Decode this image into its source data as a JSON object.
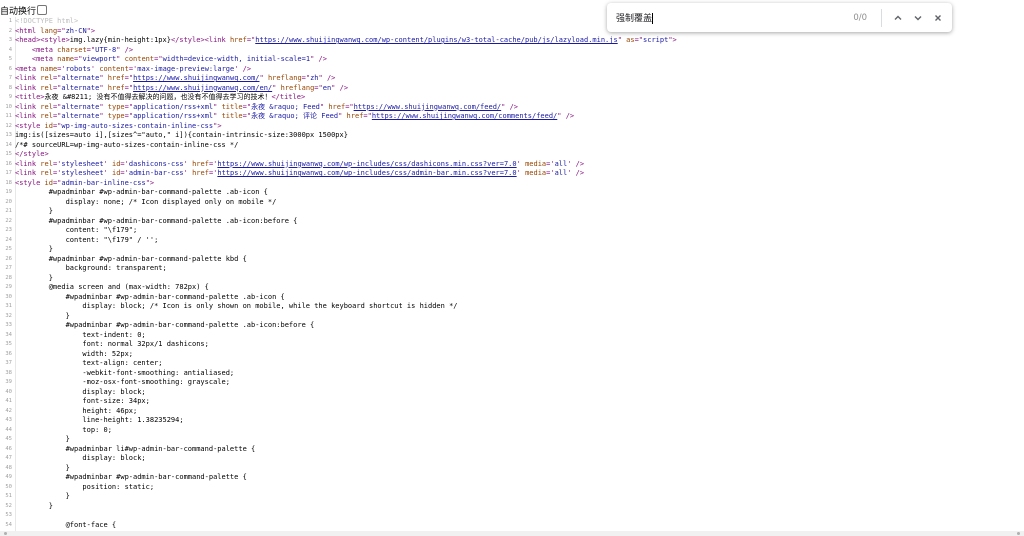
{
  "wrap_toggle": {
    "label": "自动换行",
    "checked": false
  },
  "find_bar": {
    "query": "强制覆盖",
    "count": "0/0",
    "icons": [
      "chevron-up-icon",
      "chevron-down-icon",
      "close-icon"
    ]
  },
  "lines": [
    {
      "n": "1",
      "parts": [
        [
          "doc",
          "<!DOCTYPE html>"
        ]
      ]
    },
    {
      "n": "2",
      "parts": [
        [
          "tag",
          "<html "
        ],
        [
          "attr",
          "lang"
        ],
        [
          "tag",
          "=\""
        ],
        [
          "val",
          "zh-CN"
        ],
        [
          "tag",
          "\">"
        ]
      ]
    },
    {
      "n": "3",
      "parts": [
        [
          "tag",
          "<head><style>"
        ],
        [
          "code",
          "img.lazy{min-height:1px}"
        ],
        [
          "tag",
          "</style><link "
        ],
        [
          "attr",
          "href"
        ],
        [
          "tag",
          "=\""
        ],
        [
          "link",
          "https://www.shuijingwanwq.com/wp-content/plugins/w3-total-cache/pub/js/lazyload.min.js"
        ],
        [
          "tag",
          "\" "
        ],
        [
          "attr",
          "as"
        ],
        [
          "tag",
          "=\""
        ],
        [
          "val",
          "script"
        ],
        [
          "tag",
          "\">"
        ]
      ]
    },
    {
      "n": "4",
      "parts": [
        [
          "code",
          "    "
        ],
        [
          "tag",
          "<meta "
        ],
        [
          "attr",
          "charset"
        ],
        [
          "tag",
          "=\""
        ],
        [
          "val",
          "UTF-8"
        ],
        [
          "tag",
          "\" />"
        ]
      ]
    },
    {
      "n": "5",
      "parts": [
        [
          "code",
          "    "
        ],
        [
          "tag",
          "<meta "
        ],
        [
          "attr",
          "name"
        ],
        [
          "tag",
          "=\""
        ],
        [
          "val",
          "viewport"
        ],
        [
          "tag",
          "\" "
        ],
        [
          "attr",
          "content"
        ],
        [
          "tag",
          "=\""
        ],
        [
          "val",
          "width=device-width, initial-scale=1"
        ],
        [
          "tag",
          "\" />"
        ]
      ]
    },
    {
      "n": "6",
      "parts": [
        [
          "tag",
          "<meta "
        ],
        [
          "attr",
          "name"
        ],
        [
          "tag",
          "='"
        ],
        [
          "val",
          "robots"
        ],
        [
          "tag",
          "' "
        ],
        [
          "attr",
          "content"
        ],
        [
          "tag",
          "='"
        ],
        [
          "val",
          "max-image-preview:large"
        ],
        [
          "tag",
          "' />"
        ]
      ]
    },
    {
      "n": "7",
      "parts": [
        [
          "tag",
          "<link "
        ],
        [
          "attr",
          "rel"
        ],
        [
          "tag",
          "=\""
        ],
        [
          "val",
          "alternate"
        ],
        [
          "tag",
          "\" "
        ],
        [
          "attr",
          "href"
        ],
        [
          "tag",
          "=\""
        ],
        [
          "link",
          "https://www.shuijingwanwq.com/"
        ],
        [
          "tag",
          "\" "
        ],
        [
          "attr",
          "hreflang"
        ],
        [
          "tag",
          "=\""
        ],
        [
          "val",
          "zh"
        ],
        [
          "tag",
          "\" />"
        ]
      ]
    },
    {
      "n": "8",
      "parts": [
        [
          "tag",
          "<link "
        ],
        [
          "attr",
          "rel"
        ],
        [
          "tag",
          "=\""
        ],
        [
          "val",
          "alternate"
        ],
        [
          "tag",
          "\" "
        ],
        [
          "attr",
          "href"
        ],
        [
          "tag",
          "=\""
        ],
        [
          "link",
          "https://www.shuijingwanwq.com/en/"
        ],
        [
          "tag",
          "\" "
        ],
        [
          "attr",
          "hreflang"
        ],
        [
          "tag",
          "=\""
        ],
        [
          "val",
          "en"
        ],
        [
          "tag",
          "\" />"
        ]
      ]
    },
    {
      "n": "9",
      "parts": [
        [
          "tag",
          "<title>"
        ],
        [
          "code",
          "永夜 &#8211; 没有不值得去解决的问题，也没有不值得去学习的技术！"
        ],
        [
          "tag",
          "</title>"
        ]
      ]
    },
    {
      "n": "10",
      "parts": [
        [
          "tag",
          "<link "
        ],
        [
          "attr",
          "rel"
        ],
        [
          "tag",
          "=\""
        ],
        [
          "val",
          "alternate"
        ],
        [
          "tag",
          "\" "
        ],
        [
          "attr",
          "type"
        ],
        [
          "tag",
          "=\""
        ],
        [
          "val",
          "application/rss+xml"
        ],
        [
          "tag",
          "\" "
        ],
        [
          "attr",
          "title"
        ],
        [
          "tag",
          "=\""
        ],
        [
          "val",
          "永夜 &raquo; Feed"
        ],
        [
          "tag",
          "\" "
        ],
        [
          "attr",
          "href"
        ],
        [
          "tag",
          "=\""
        ],
        [
          "link",
          "https://www.shuijingwanwq.com/feed/"
        ],
        [
          "tag",
          "\" />"
        ]
      ]
    },
    {
      "n": "11",
      "parts": [
        [
          "tag",
          "<link "
        ],
        [
          "attr",
          "rel"
        ],
        [
          "tag",
          "=\""
        ],
        [
          "val",
          "alternate"
        ],
        [
          "tag",
          "\" "
        ],
        [
          "attr",
          "type"
        ],
        [
          "tag",
          "=\""
        ],
        [
          "val",
          "application/rss+xml"
        ],
        [
          "tag",
          "\" "
        ],
        [
          "attr",
          "title"
        ],
        [
          "tag",
          "=\""
        ],
        [
          "val",
          "永夜 &raquo; 评论 Feed"
        ],
        [
          "tag",
          "\" "
        ],
        [
          "attr",
          "href"
        ],
        [
          "tag",
          "=\""
        ],
        [
          "link",
          "https://www.shuijingwanwq.com/comments/feed/"
        ],
        [
          "tag",
          "\" />"
        ]
      ]
    },
    {
      "n": "12",
      "parts": [
        [
          "tag",
          "<style "
        ],
        [
          "attr",
          "id"
        ],
        [
          "tag",
          "=\""
        ],
        [
          "val",
          "wp-img-auto-sizes-contain-inline-css"
        ],
        [
          "tag",
          "\">"
        ]
      ]
    },
    {
      "n": "13",
      "parts": [
        [
          "code",
          "img:is([sizes=auto i],[sizes^=\"auto,\" i]){contain-intrinsic-size:3000px 1500px}"
        ]
      ]
    },
    {
      "n": "14",
      "parts": [
        [
          "code",
          "/*# sourceURL=wp-img-auto-sizes-contain-inline-css */"
        ]
      ]
    },
    {
      "n": "15",
      "parts": [
        [
          "tag",
          "</style>"
        ]
      ]
    },
    {
      "n": "16",
      "parts": [
        [
          "tag",
          "<link "
        ],
        [
          "attr",
          "rel"
        ],
        [
          "tag",
          "='"
        ],
        [
          "val",
          "stylesheet"
        ],
        [
          "tag",
          "' "
        ],
        [
          "attr",
          "id"
        ],
        [
          "tag",
          "='"
        ],
        [
          "val",
          "dashicons-css"
        ],
        [
          "tag",
          "' "
        ],
        [
          "attr",
          "href"
        ],
        [
          "tag",
          "='"
        ],
        [
          "link",
          "https://www.shuijingwanwq.com/wp-includes/css/dashicons.min.css?ver=7.0"
        ],
        [
          "tag",
          "' "
        ],
        [
          "attr",
          "media"
        ],
        [
          "tag",
          "='"
        ],
        [
          "val",
          "all"
        ],
        [
          "tag",
          "' />"
        ]
      ]
    },
    {
      "n": "17",
      "parts": [
        [
          "tag",
          "<link "
        ],
        [
          "attr",
          "rel"
        ],
        [
          "tag",
          "='"
        ],
        [
          "val",
          "stylesheet"
        ],
        [
          "tag",
          "' "
        ],
        [
          "attr",
          "id"
        ],
        [
          "tag",
          "='"
        ],
        [
          "val",
          "admin-bar-css"
        ],
        [
          "tag",
          "' "
        ],
        [
          "attr",
          "href"
        ],
        [
          "tag",
          "='"
        ],
        [
          "link",
          "https://www.shuijingwanwq.com/wp-includes/css/admin-bar.min.css?ver=7.0"
        ],
        [
          "tag",
          "' "
        ],
        [
          "attr",
          "media"
        ],
        [
          "tag",
          "='"
        ],
        [
          "val",
          "all"
        ],
        [
          "tag",
          "' />"
        ]
      ]
    },
    {
      "n": "18",
      "parts": [
        [
          "tag",
          "<style "
        ],
        [
          "attr",
          "id"
        ],
        [
          "tag",
          "=\""
        ],
        [
          "val",
          "admin-bar-inline-css"
        ],
        [
          "tag",
          "\">"
        ]
      ]
    },
    {
      "n": "19",
      "parts": [
        [
          "code",
          "        #wpadminbar #wp-admin-bar-command-palette .ab-icon {"
        ]
      ]
    },
    {
      "n": "20",
      "parts": [
        [
          "code",
          "            display: none; /* Icon displayed only on mobile */"
        ]
      ]
    },
    {
      "n": "21",
      "parts": [
        [
          "code",
          "        }"
        ]
      ]
    },
    {
      "n": "22",
      "parts": [
        [
          "code",
          "        #wpadminbar #wp-admin-bar-command-palette .ab-icon:before {"
        ]
      ]
    },
    {
      "n": "23",
      "parts": [
        [
          "code",
          "            content: \"\\f179\";"
        ]
      ]
    },
    {
      "n": "24",
      "parts": [
        [
          "code",
          "            content: \"\\f179\" / '';"
        ]
      ]
    },
    {
      "n": "25",
      "parts": [
        [
          "code",
          "        }"
        ]
      ]
    },
    {
      "n": "26",
      "parts": [
        [
          "code",
          "        #wpadminbar #wp-admin-bar-command-palette kbd {"
        ]
      ]
    },
    {
      "n": "27",
      "parts": [
        [
          "code",
          "            background: transparent;"
        ]
      ]
    },
    {
      "n": "28",
      "parts": [
        [
          "code",
          "        }"
        ]
      ]
    },
    {
      "n": "29",
      "parts": [
        [
          "code",
          "        @media screen and (max-width: 782px) {"
        ]
      ]
    },
    {
      "n": "30",
      "parts": [
        [
          "code",
          "            #wpadminbar #wp-admin-bar-command-palette .ab-icon {"
        ]
      ]
    },
    {
      "n": "31",
      "parts": [
        [
          "code",
          "                display: block; /* Icon is only shown on mobile, while the keyboard shortcut is hidden */"
        ]
      ]
    },
    {
      "n": "32",
      "parts": [
        [
          "code",
          "            }"
        ]
      ]
    },
    {
      "n": "33",
      "parts": [
        [
          "code",
          "            #wpadminbar #wp-admin-bar-command-palette .ab-icon:before {"
        ]
      ]
    },
    {
      "n": "34",
      "parts": [
        [
          "code",
          "                text-indent: 0;"
        ]
      ]
    },
    {
      "n": "35",
      "parts": [
        [
          "code",
          "                font: normal 32px/1 dashicons;"
        ]
      ]
    },
    {
      "n": "36",
      "parts": [
        [
          "code",
          "                width: 52px;"
        ]
      ]
    },
    {
      "n": "37",
      "parts": [
        [
          "code",
          "                text-align: center;"
        ]
      ]
    },
    {
      "n": "38",
      "parts": [
        [
          "code",
          "                -webkit-font-smoothing: antialiased;"
        ]
      ]
    },
    {
      "n": "39",
      "parts": [
        [
          "code",
          "                -moz-osx-font-smoothing: grayscale;"
        ]
      ]
    },
    {
      "n": "40",
      "parts": [
        [
          "code",
          "                display: block;"
        ]
      ]
    },
    {
      "n": "41",
      "parts": [
        [
          "code",
          "                font-size: 34px;"
        ]
      ]
    },
    {
      "n": "42",
      "parts": [
        [
          "code",
          "                height: 46px;"
        ]
      ]
    },
    {
      "n": "43",
      "parts": [
        [
          "code",
          "                line-height: 1.38235294;"
        ]
      ]
    },
    {
      "n": "44",
      "parts": [
        [
          "code",
          "                top: 0;"
        ]
      ]
    },
    {
      "n": "45",
      "parts": [
        [
          "code",
          "            }"
        ]
      ]
    },
    {
      "n": "46",
      "parts": [
        [
          "code",
          "            #wpadminbar li#wp-admin-bar-command-palette {"
        ]
      ]
    },
    {
      "n": "47",
      "parts": [
        [
          "code",
          "                display: block;"
        ]
      ]
    },
    {
      "n": "48",
      "parts": [
        [
          "code",
          "            }"
        ]
      ]
    },
    {
      "n": "49",
      "parts": [
        [
          "code",
          "            #wpadminbar #wp-admin-bar-command-palette {"
        ]
      ]
    },
    {
      "n": "50",
      "parts": [
        [
          "code",
          "                position: static;"
        ]
      ]
    },
    {
      "n": "51",
      "parts": [
        [
          "code",
          "            }"
        ]
      ]
    },
    {
      "n": "52",
      "parts": [
        [
          "code",
          "        }"
        ]
      ]
    },
    {
      "n": "53",
      "parts": [
        [
          "code",
          ""
        ]
      ]
    },
    {
      "n": "54",
      "parts": [
        [
          "code",
          "            @font-face {"
        ]
      ]
    }
  ]
}
